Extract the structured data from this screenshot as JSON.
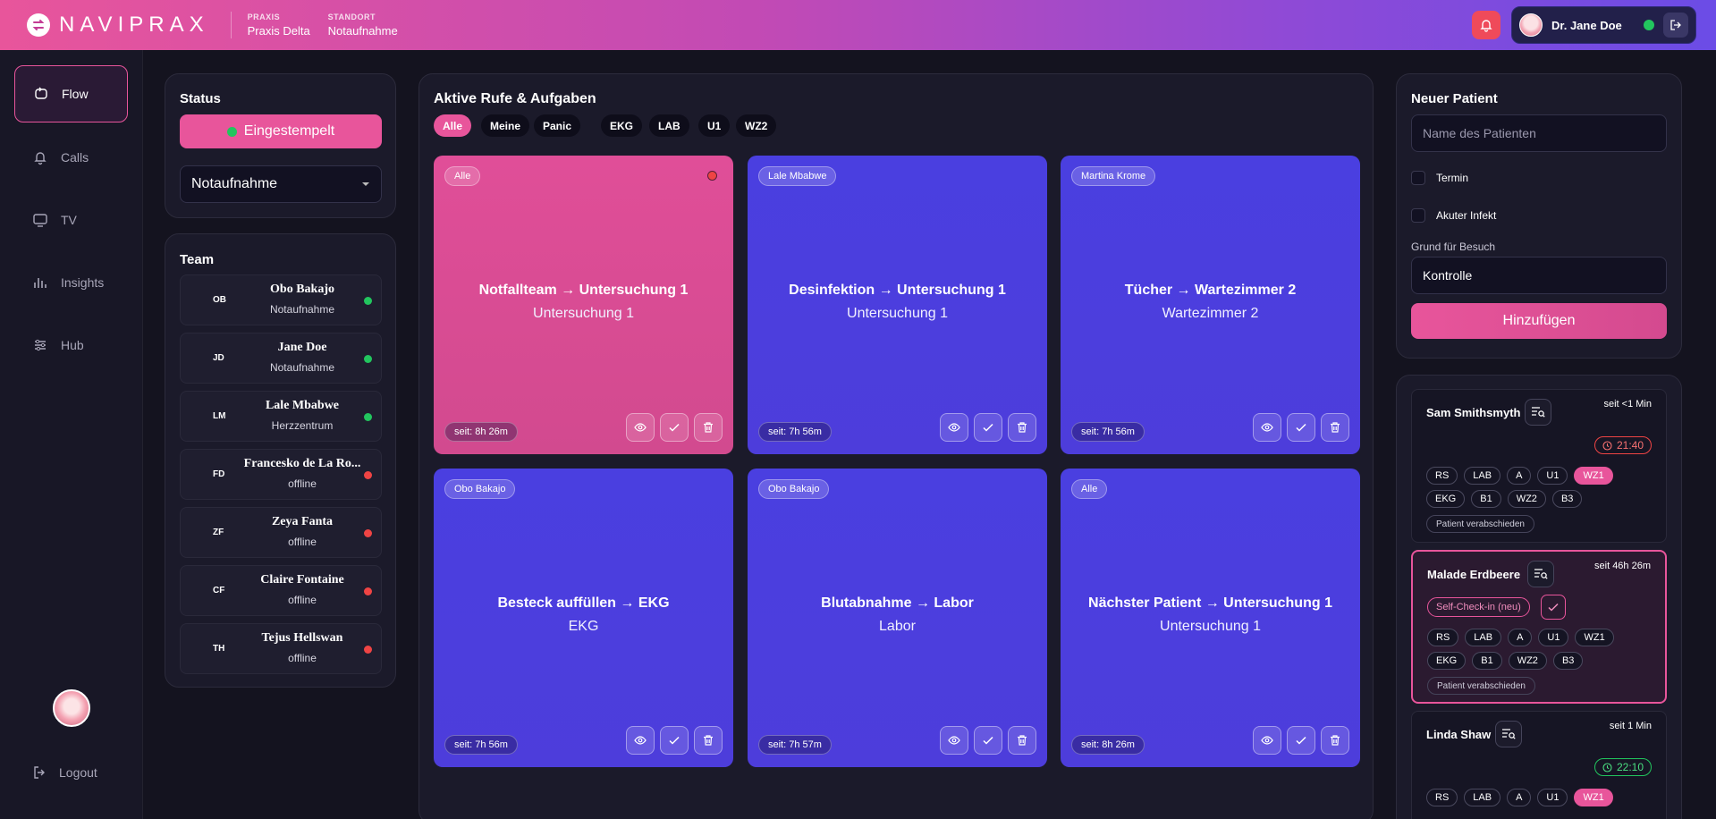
{
  "header": {
    "brand": "NAVIPRAX",
    "praxis_label": "PRAXIS",
    "praxis_value": "Praxis Delta",
    "standort_label": "STANDORT",
    "standort_value": "Notaufnahme",
    "user_name": "Dr. Jane Doe",
    "gradient": [
      "#e8559b",
      "#6b4ce6"
    ]
  },
  "sidebar": {
    "items": [
      {
        "label": "Flow",
        "icon": "flow-icon"
      },
      {
        "label": "Calls",
        "icon": "bell-icon"
      },
      {
        "label": "TV",
        "icon": "tv-icon"
      },
      {
        "label": "Insights",
        "icon": "chart-icon"
      },
      {
        "label": "Hub",
        "icon": "sliders-icon"
      }
    ],
    "logout": "Logout"
  },
  "status": {
    "title": "Status",
    "button": "Eingestempelt",
    "selected": "Notaufnahme"
  },
  "team": {
    "title": "Team",
    "members": [
      {
        "initials": "OB",
        "name": "Obo Bakajo",
        "dept": "Notaufnahme",
        "online": true
      },
      {
        "initials": "JD",
        "name": "Jane Doe",
        "dept": "Notaufnahme",
        "online": true
      },
      {
        "initials": "LM",
        "name": "Lale Mbabwe",
        "dept": "Herzzentrum",
        "online": true
      },
      {
        "initials": "FD",
        "name": "Francesko de La Ro...",
        "dept": "offline",
        "online": false
      },
      {
        "initials": "ZF",
        "name": "Zeya Fanta",
        "dept": "offline",
        "online": false
      },
      {
        "initials": "CF",
        "name": "Claire Fontaine",
        "dept": "offline",
        "online": false
      },
      {
        "initials": "TH",
        "name": "Tejus Hellswan",
        "dept": "offline",
        "online": false
      }
    ]
  },
  "tasks": {
    "title": "Aktive Rufe & Aufgaben",
    "filters": [
      "Alle",
      "Meine",
      "Panic",
      "EKG",
      "LAB",
      "U1",
      "WZ2"
    ],
    "active_filter": "Alle",
    "cards": [
      {
        "tag": "Alle",
        "title": "Notfallteam → Untersuchung 1",
        "sub": "Untersuchung 1",
        "time": "seit: 8h 26m",
        "urgent": true
      },
      {
        "tag": "Lale Mbabwe",
        "title": "Desinfektion → Untersuchung 1",
        "sub": "Untersuchung 1",
        "time": "seit: 7h 56m",
        "urgent": false
      },
      {
        "tag": "Martina Krome",
        "title": "Tücher → Wartezimmer 2",
        "sub": "Wartezimmer 2",
        "time": "seit: 7h 56m",
        "urgent": false
      },
      {
        "tag": "Obo Bakajo",
        "title": "Besteck auffüllen → EKG",
        "sub": "EKG",
        "time": "seit: 7h 56m",
        "urgent": false
      },
      {
        "tag": "Obo Bakajo",
        "title": "Blutabnahme → Labor",
        "sub": "Labor",
        "time": "seit: 7h 57m",
        "urgent": false
      },
      {
        "tag": "Alle",
        "title": "Nächster Patient → Untersuchung 1",
        "sub": "Untersuchung 1",
        "time": "seit: 8h 26m",
        "urgent": false
      }
    ]
  },
  "new_patient": {
    "title": "Neuer Patient",
    "name_placeholder": "Name des Patienten",
    "checkbox_termin": "Termin",
    "checkbox_infekt": "Akuter Infekt",
    "reason_label": "Grund für Besuch",
    "reason_value": "Kontrolle",
    "add_button": "Hinzufügen"
  },
  "patients": [
    {
      "name": "Sam Smithsmyth",
      "since": "seit <1 Min",
      "time": "21:40",
      "time_color": "red",
      "tags_row1": [
        "RS",
        "LAB",
        "A",
        "U1",
        "WZ1"
      ],
      "tags_row2": [
        "EKG",
        "B1",
        "WZ2",
        "B3"
      ],
      "active_tag": "WZ1",
      "farewell": "Patient verabschieden"
    },
    {
      "name": "Malade Erdbeere",
      "since": "seit 46h 26m",
      "self_checkin": "Self-Check-in (neu)",
      "tags_row1": [
        "RS",
        "LAB",
        "A",
        "U1",
        "WZ1"
      ],
      "tags_row2": [
        "EKG",
        "B1",
        "WZ2",
        "B3"
      ],
      "active_tag": "",
      "farewell": "Patient verabschieden"
    },
    {
      "name": "Linda Shaw",
      "since": "seit 1 Min",
      "time": "22:10",
      "time_color": "green",
      "tags_row1": [
        "RS",
        "LAB",
        "A",
        "U1",
        "WZ1"
      ],
      "active_tag": "WZ1"
    }
  ]
}
